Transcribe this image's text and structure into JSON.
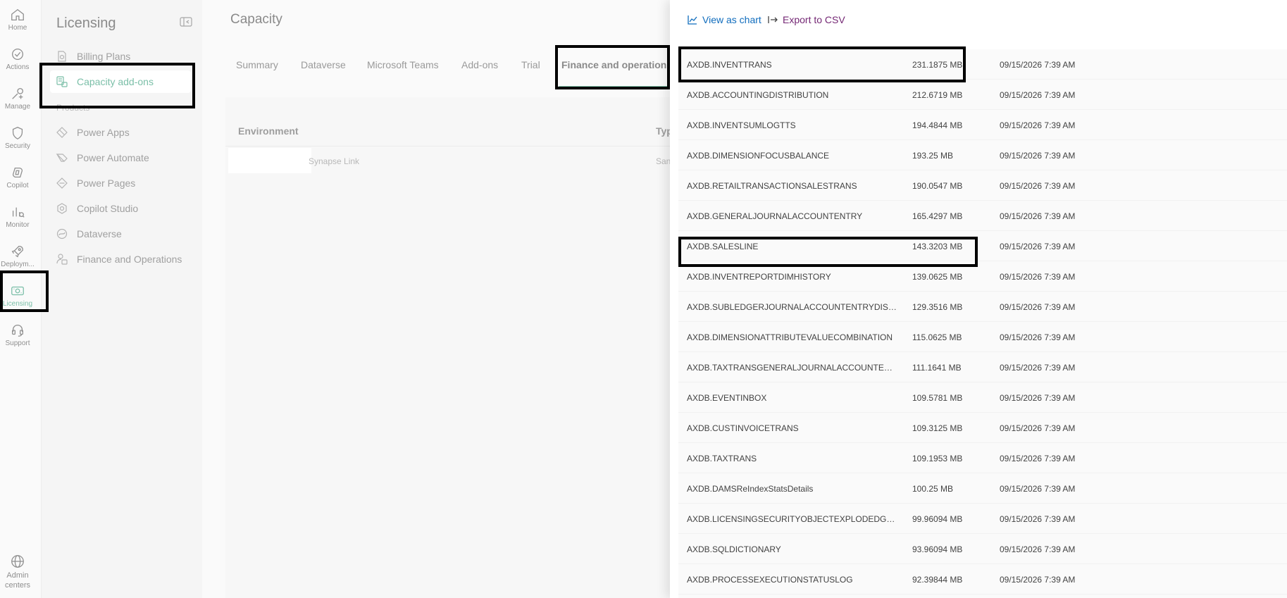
{
  "rail": {
    "items": [
      {
        "label": "Home",
        "icon": "home-icon"
      },
      {
        "label": "Actions",
        "icon": "actions-icon"
      },
      {
        "label": "Manage",
        "icon": "manage-icon"
      },
      {
        "label": "Security",
        "icon": "shield-icon"
      },
      {
        "label": "Copilot",
        "icon": "copilot-icon"
      },
      {
        "label": "Monitor",
        "icon": "monitor-icon"
      },
      {
        "label": "Deploym...",
        "icon": "rocket-icon"
      },
      {
        "label": "Licensing",
        "icon": "licensing-icon",
        "active": true
      },
      {
        "label": "Support",
        "icon": "headset-icon"
      }
    ],
    "admin_centers_label": "Admin centers"
  },
  "nav": {
    "title": "Licensing",
    "items": [
      {
        "label": "Billing Plans",
        "icon": "billing-icon"
      },
      {
        "label": "Capacity add-ons",
        "icon": "capacity-icon",
        "selected": true
      }
    ],
    "section_label": "Products",
    "products": [
      {
        "label": "Power Apps",
        "icon": "power-apps-icon"
      },
      {
        "label": "Power Automate",
        "icon": "power-automate-icon"
      },
      {
        "label": "Power Pages",
        "icon": "power-pages-icon"
      },
      {
        "label": "Copilot Studio",
        "icon": "copilot-studio-icon"
      },
      {
        "label": "Dataverse",
        "icon": "dataverse-icon"
      },
      {
        "label": "Finance and Operations",
        "icon": "finance-operations-icon"
      }
    ]
  },
  "main": {
    "title": "Capacity",
    "tabs": [
      "Summary",
      "Dataverse",
      "Microsoft Teams",
      "Add-ons",
      "Trial",
      "Finance and operations"
    ],
    "selected_tab": "Finance and operations",
    "table": {
      "headers": [
        "Environment",
        "Typ"
      ],
      "row": {
        "name_suffix": "Synapse Link",
        "type": "San"
      }
    }
  },
  "panel": {
    "view_as_chart_label": "View as chart",
    "export_csv_label": "Export to CSV",
    "rows": [
      {
        "name": "AXDB.INVENTTRANS",
        "size": "231.1875 MB",
        "date": "09/15/2026 7:39 AM"
      },
      {
        "name": "AXDB.ACCOUNTINGDISTRIBUTION",
        "size": "212.6719 MB",
        "date": "09/15/2026 7:39 AM"
      },
      {
        "name": "AXDB.INVENTSUMLOGTTS",
        "size": "194.4844 MB",
        "date": "09/15/2026 7:39 AM"
      },
      {
        "name": "AXDB.DIMENSIONFOCUSBALANCE",
        "size": "193.25 MB",
        "date": "09/15/2026 7:39 AM"
      },
      {
        "name": "AXDB.RETAILTRANSACTIONSALESTRANS",
        "size": "190.0547 MB",
        "date": "09/15/2026 7:39 AM"
      },
      {
        "name": "AXDB.GENERALJOURNALACCOUNTENTRY",
        "size": "165.4297 MB",
        "date": "09/15/2026 7:39 AM"
      },
      {
        "name": "AXDB.SALESLINE",
        "size": "143.3203 MB",
        "date": "09/15/2026 7:39 AM"
      },
      {
        "name": "AXDB.INVENTREPORTDIMHISTORY",
        "size": "139.0625 MB",
        "date": "09/15/2026 7:39 AM"
      },
      {
        "name": "AXDB.SUBLEDGERJOURNALACCOUNTENTRYDISTRIBU...",
        "size": "129.3516 MB",
        "date": "09/15/2026 7:39 AM"
      },
      {
        "name": "AXDB.DIMENSIONATTRIBUTEVALUECOMBINATION",
        "size": "115.0625 MB",
        "date": "09/15/2026 7:39 AM"
      },
      {
        "name": "AXDB.TAXTRANSGENERALJOURNALACCOUNTENTRY",
        "size": "111.1641 MB",
        "date": "09/15/2026 7:39 AM"
      },
      {
        "name": "AXDB.EVENTINBOX",
        "size": "109.5781 MB",
        "date": "09/15/2026 7:39 AM"
      },
      {
        "name": "AXDB.CUSTINVOICETRANS",
        "size": "109.3125 MB",
        "date": "09/15/2026 7:39 AM"
      },
      {
        "name": "AXDB.TAXTRANS",
        "size": "109.1953 MB",
        "date": "09/15/2026 7:39 AM"
      },
      {
        "name": "AXDB.DAMSReIndexStatsDetails",
        "size": "100.25 MB",
        "date": "09/15/2026 7:39 AM"
      },
      {
        "name": "AXDB.LICENSINGSECURITYOBJECTEXPLODEDGRAPH",
        "size": "99.96094 MB",
        "date": "09/15/2026 7:39 AM"
      },
      {
        "name": "AXDB.SQLDICTIONARY",
        "size": "93.96094 MB",
        "date": "09/15/2026 7:39 AM"
      },
      {
        "name": "AXDB.PROCESSEXECUTIONSTATUSLOG",
        "size": "92.39844 MB",
        "date": "09/15/2026 7:39 AM"
      }
    ]
  },
  "colors": {
    "accent": "#7bbfa8",
    "link": "#0f6cbd",
    "export_link": "#742774",
    "highlight_box": "#000000"
  }
}
